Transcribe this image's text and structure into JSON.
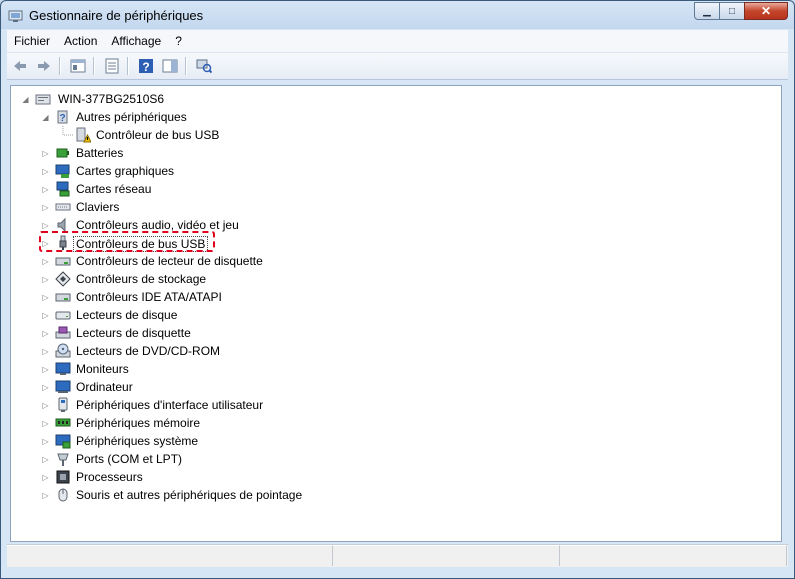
{
  "window": {
    "title": "Gestionnaire de périphériques",
    "minimize_glyph": "▁",
    "maximize_glyph": "□",
    "close_glyph": "✕"
  },
  "menu": [
    "Fichier",
    "Action",
    "Affichage",
    "?"
  ],
  "toolbar": [
    {
      "icon": "back-arrow-icon"
    },
    {
      "icon": "forward-arrow-icon"
    },
    {
      "icon": "show-hide-console-tree-icon"
    },
    {
      "icon": "properties-icon"
    },
    {
      "icon": "help-icon"
    },
    {
      "icon": "action-pane-icon"
    },
    {
      "icon": "scan-hardware-changes-icon"
    }
  ],
  "tree": {
    "root": "WIN-377BG2510S6",
    "other_devices": "Autres périphériques",
    "other_child": "Contrôleur de bus USB",
    "categories": [
      "Batteries",
      "Cartes graphiques",
      "Cartes réseau",
      "Claviers",
      "Contrôleurs audio, vidéo et jeu",
      "Contrôleurs de bus USB",
      "Contrôleurs de lecteur de disquette",
      "Contrôleurs de stockage",
      "Contrôleurs IDE ATA/ATAPI",
      "Lecteurs de disque",
      "Lecteurs de disquette",
      "Lecteurs de DVD/CD-ROM",
      "Moniteurs",
      "Ordinateur",
      "Périphériques d'interface utilisateur",
      "Périphériques mémoire",
      "Périphériques système",
      "Ports (COM et LPT)",
      "Processeurs",
      "Souris et autres périphériques de pointage"
    ],
    "selected_category": "Contrôleurs de bus USB"
  },
  "colors": {
    "highlight_border": "#e0001b",
    "warning": "#f2c200"
  }
}
